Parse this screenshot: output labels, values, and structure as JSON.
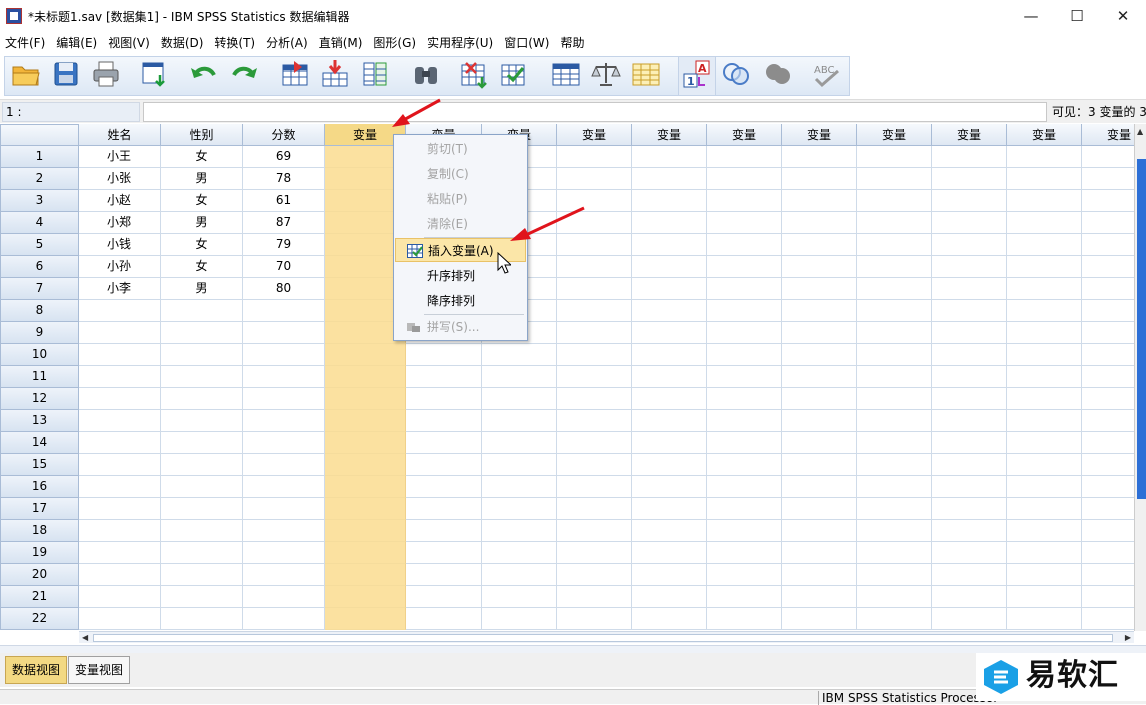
{
  "window": {
    "title": "*未标题1.sav [数据集1] - IBM SPSS Statistics 数据编辑器",
    "minimize": "—",
    "maximize": "☐",
    "close": "✕"
  },
  "menu": [
    "文件(F)",
    "编辑(E)",
    "视图(V)",
    "数据(D)",
    "转换(T)",
    "分析(A)",
    "直销(M)",
    "图形(G)",
    "实用程序(U)",
    "窗口(W)",
    "帮助"
  ],
  "toolbar_icons": [
    "open-folder-icon",
    "save-icon",
    "print-icon",
    "recall-dialog-icon",
    "undo-icon",
    "redo-icon",
    "goto-case-icon",
    "goto-variable-icon",
    "variables-icon",
    "find-icon",
    "insert-cases-icon",
    "insert-variable-icon",
    "split-file-icon",
    "weight-cases-icon",
    "select-cases-icon",
    "value-labels-icon",
    "use-sets-icon",
    "show-all-variables-icon",
    "spell-check-icon"
  ],
  "cellbar": {
    "ref": "1 :",
    "value": "",
    "visible": "可见：3 变量的 3"
  },
  "columns": [
    "姓名",
    "性别",
    "分数",
    "变量",
    "变量",
    "变量",
    "变量",
    "变量",
    "变量",
    "变量",
    "变量",
    "变量",
    "变量",
    "变量"
  ],
  "rows": [
    [
      "1",
      "小王",
      "女",
      "69"
    ],
    [
      "2",
      "小张",
      "男",
      "78"
    ],
    [
      "3",
      "小赵",
      "女",
      "61"
    ],
    [
      "4",
      "小郑",
      "男",
      "87"
    ],
    [
      "5",
      "小钱",
      "女",
      "79"
    ],
    [
      "6",
      "小孙",
      "女",
      "70"
    ],
    [
      "7",
      "小李",
      "男",
      "80"
    ],
    [
      "8",
      "",
      "",
      ""
    ],
    [
      "9",
      "",
      "",
      ""
    ],
    [
      "10",
      "",
      "",
      ""
    ],
    [
      "11",
      "",
      "",
      ""
    ],
    [
      "12",
      "",
      "",
      ""
    ],
    [
      "13",
      "",
      "",
      ""
    ],
    [
      "14",
      "",
      "",
      ""
    ],
    [
      "15",
      "",
      "",
      ""
    ],
    [
      "16",
      "",
      "",
      ""
    ],
    [
      "17",
      "",
      "",
      ""
    ],
    [
      "18",
      "",
      "",
      ""
    ],
    [
      "19",
      "",
      "",
      ""
    ],
    [
      "20",
      "",
      "",
      ""
    ],
    [
      "21",
      "",
      "",
      ""
    ],
    [
      "22",
      "",
      "",
      ""
    ]
  ],
  "context_menu": [
    {
      "label": "剪切(T)",
      "enabled": false
    },
    {
      "label": "复制(C)",
      "enabled": false
    },
    {
      "label": "粘贴(P)",
      "enabled": false
    },
    {
      "label": "清除(E)",
      "enabled": false
    },
    {
      "label": "插入变量(A)",
      "enabled": true,
      "highlighted": true
    },
    {
      "label": "升序排列",
      "enabled": true
    },
    {
      "label": "降序排列",
      "enabled": true
    },
    {
      "label": "拼写(S)...",
      "enabled": false
    }
  ],
  "tabs": {
    "data_view": "数据视图",
    "variable_view": "变量视图"
  },
  "status": "IBM SPSS Statistics Processor",
  "watermark": "易软汇",
  "colors": {
    "selected_column": "#fbe1a0",
    "arrow": "#e0141c",
    "scroll_thumb": "#2c6fd6"
  }
}
